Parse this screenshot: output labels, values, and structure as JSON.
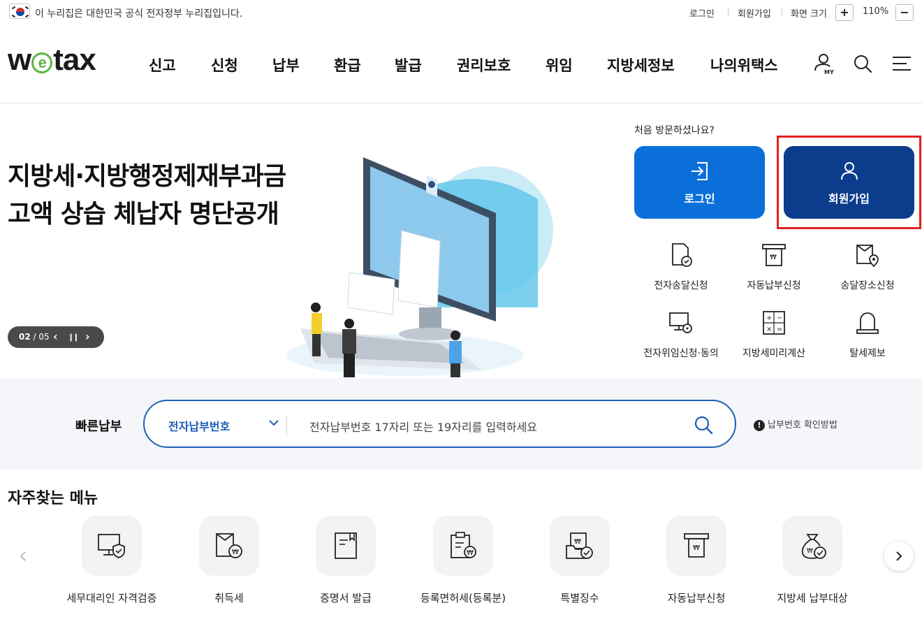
{
  "gov_banner": {
    "text": "이 누리집은 대한민국 공식 전자정부 누리집입니다.",
    "login": "로그인",
    "signup": "회원가입",
    "font_size_label": "화면 크기",
    "zoom_in": "+",
    "zoom_level": "110%",
    "zoom_out": "−"
  },
  "header": {
    "logo_w": "w",
    "logo_e": "e",
    "logo_rest": "tax",
    "nav": [
      "신고",
      "신청",
      "납부",
      "환급",
      "발급",
      "권리보호",
      "위임",
      "지방세정보",
      "나의위택스"
    ],
    "my_badge": "MY"
  },
  "hero": {
    "title_line1": "지방세·지방행정제재부과금",
    "title_line2": "고액 상습 체납자 명단공개",
    "slide_current": "02",
    "slide_total": "/ 05",
    "prev": "‹",
    "pause": "❙❙",
    "next": "›"
  },
  "side_panel": {
    "first_visit": "처음 방문하셨나요?",
    "login_label": "로그인",
    "signup_label": "회원가입",
    "quick_links": [
      "전자송달신청",
      "자동납부신청",
      "송달장소신청",
      "전자위임신청·동의",
      "지방세미리계산",
      "탈세제보"
    ]
  },
  "quick_pay": {
    "title": "빠른납부",
    "select_value": "전자납부번호",
    "placeholder": "전자납부번호 17자리 또는 19자리를 입력하세요",
    "help_icon": "!",
    "help": "납부번호 확인방법"
  },
  "favorites": {
    "title": "자주찾는 메뉴",
    "items": [
      "세무대리인 자격검증",
      "취득세",
      "증명서 발급",
      "등록면허세(등록분)",
      "특별징수",
      "자동납부신청",
      "지방세 납부대상"
    ]
  },
  "colors": {
    "primary_blue": "#0a6fd8",
    "navy": "#0b3d8c",
    "accent_green": "#5fb53f",
    "highlight_red": "#e02020"
  }
}
